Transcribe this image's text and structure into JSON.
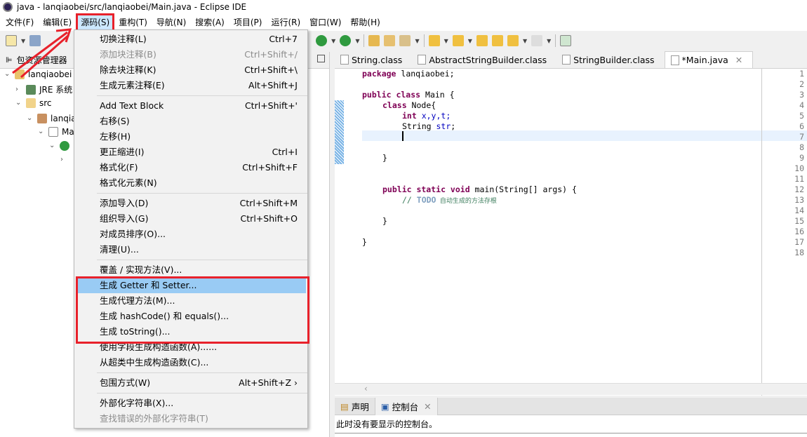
{
  "window": {
    "title": "java - lanqiaobei/src/lanqiaobei/Main.java - Eclipse IDE"
  },
  "menubar": [
    {
      "label": "文件(F)"
    },
    {
      "label": "编辑(E)"
    },
    {
      "label": "源码(S)"
    },
    {
      "label": "重构(T)"
    },
    {
      "label": "导航(N)"
    },
    {
      "label": "搜索(A)"
    },
    {
      "label": "项目(P)"
    },
    {
      "label": "运行(R)"
    },
    {
      "label": "窗口(W)"
    },
    {
      "label": "帮助(H)"
    }
  ],
  "package_explorer": {
    "title": "包资源管理器",
    "project": "lanqiaobei",
    "jre": "JRE 系统",
    "src": "src",
    "package": "lanqia",
    "file": "Ma"
  },
  "editor": {
    "tabs": [
      {
        "label": "String.class"
      },
      {
        "label": "AbstractStringBuilder.class"
      },
      {
        "label": "StringBuilder.class"
      },
      {
        "label": "*Main.java"
      }
    ],
    "lines": [
      "1",
      "2",
      "3",
      "4",
      "5",
      "6",
      "7",
      "8",
      "9",
      "10",
      "11",
      "12",
      "13",
      "14",
      "15",
      "16",
      "17",
      "18"
    ],
    "code": {
      "l1kw": "package",
      "l1": " lanqiaobei;",
      "l3kw": "public class",
      "l3": " Main {",
      "l4kw": "class",
      "l4": " Node{",
      "l5kw": "int",
      "l5": " x,y,t;",
      "l6": "String ",
      "l6f": "str",
      "l6e": ";",
      "l9": "}",
      "l12kw": "public static void",
      "l12": " main(String[] args) {",
      "l13c": "// ",
      "l13t": "TODO",
      "l13": " 自动生成的方法存根",
      "l15": "}",
      "l17": "}"
    }
  },
  "bottom": {
    "tabs": [
      {
        "label": "声明"
      },
      {
        "label": "控制台"
      }
    ],
    "message": "此时没有要显示的控制台。"
  },
  "source_menu": {
    "items": [
      {
        "label": "切换注释(L)",
        "shortcut": "Ctrl+7"
      },
      {
        "label": "添加块注释(B)",
        "shortcut": "Ctrl+Shift+/",
        "disabled": true
      },
      {
        "label": "除去块注释(K)",
        "shortcut": "Ctrl+Shift+\\"
      },
      {
        "label": "生成元素注释(E)",
        "shortcut": "Alt+Shift+J"
      },
      {
        "label": "Add Text Block",
        "shortcut": "Ctrl+Shift+'"
      },
      {
        "label": "右移(S)",
        "shortcut": ""
      },
      {
        "label": "左移(H)",
        "shortcut": ""
      },
      {
        "label": "更正缩进(I)",
        "shortcut": "Ctrl+I"
      },
      {
        "label": "格式化(F)",
        "shortcut": "Ctrl+Shift+F"
      },
      {
        "label": "格式化元素(N)",
        "shortcut": ""
      },
      {
        "label": "添加导入(D)",
        "shortcut": "Ctrl+Shift+M"
      },
      {
        "label": "组织导入(G)",
        "shortcut": "Ctrl+Shift+O"
      },
      {
        "label": "对成员排序(O)...",
        "shortcut": ""
      },
      {
        "label": "清理(U)...",
        "shortcut": ""
      },
      {
        "label": "覆盖 / 实现方法(V)...",
        "shortcut": ""
      },
      {
        "label": "生成 Getter 和 Setter...",
        "shortcut": "",
        "highlighted": true
      },
      {
        "label": "生成代理方法(M)...",
        "shortcut": ""
      },
      {
        "label": "生成 hashCode() 和 equals()...",
        "shortcut": ""
      },
      {
        "label": "生成 toString()...",
        "shortcut": ""
      },
      {
        "label": "使用字段生成构造函数(A)......",
        "shortcut": ""
      },
      {
        "label": "从超类中生成构造函数(C)...",
        "shortcut": ""
      },
      {
        "label": "包围方式(W)",
        "shortcut": "Alt+Shift+Z ›"
      },
      {
        "label": "外部化字符串(X)...",
        "shortcut": ""
      },
      {
        "label": "查找错误的外部化字符串(T)",
        "shortcut": "",
        "disabled": true
      }
    ]
  },
  "colors": {
    "annotation": "#e8212b",
    "highlight": "#99cbf4",
    "keyword": "#7f0055"
  }
}
